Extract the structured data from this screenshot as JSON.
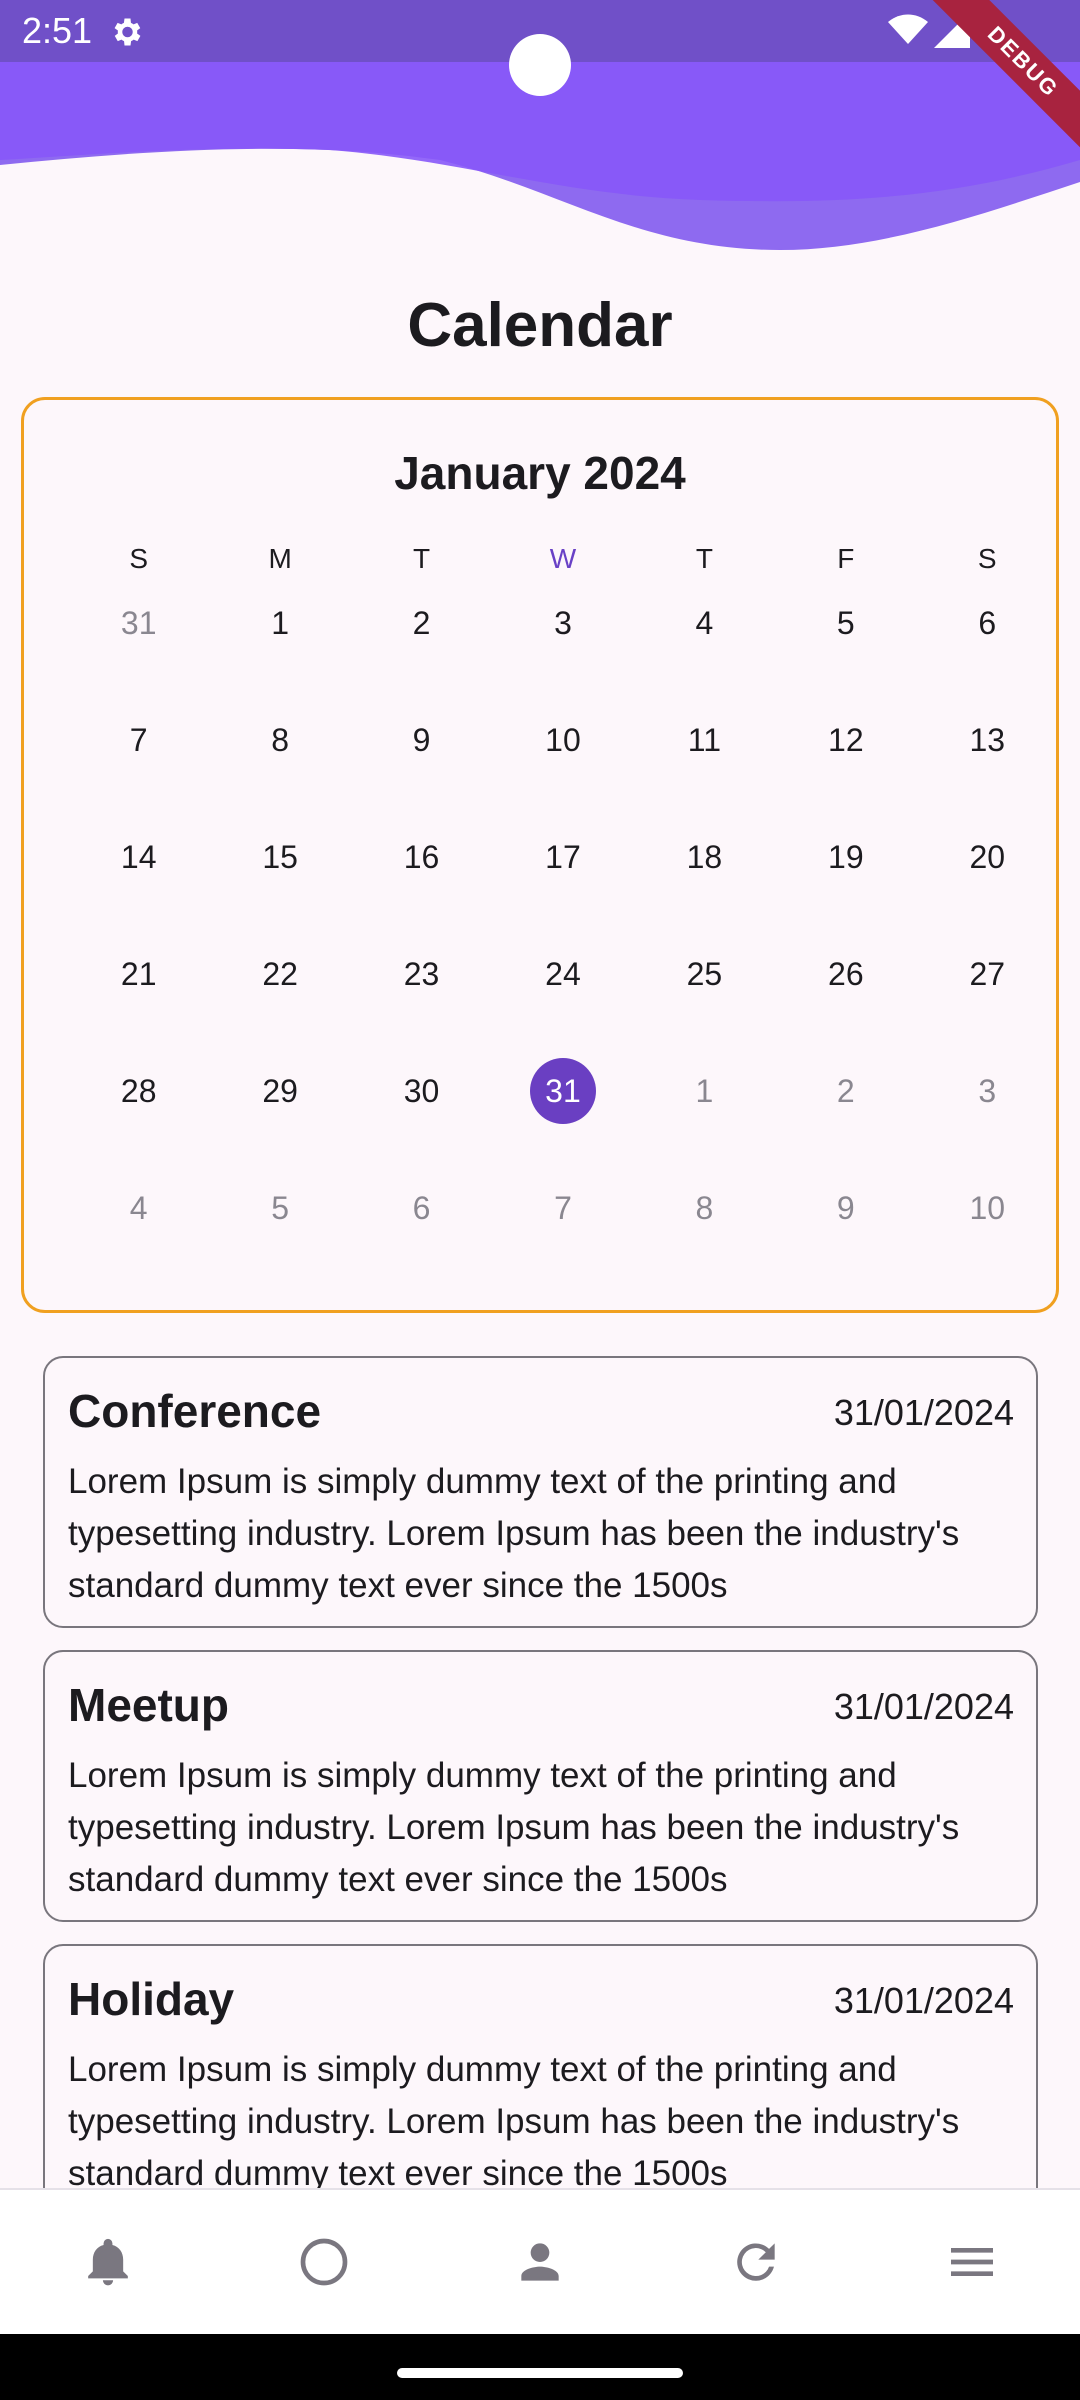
{
  "status_bar": {
    "time": "2:51",
    "debug_label": "DEBUG"
  },
  "page": {
    "title": "Calendar"
  },
  "calendar": {
    "month_label": "January 2024",
    "weekdays": [
      "S",
      "M",
      "T",
      "W",
      "T",
      "F",
      "S"
    ],
    "today_weekday_index": 3,
    "weeks": [
      [
        "31",
        "1",
        "2",
        "3",
        "4",
        "5",
        "6"
      ],
      [
        "7",
        "8",
        "9",
        "10",
        "11",
        "12",
        "13"
      ],
      [
        "14",
        "15",
        "16",
        "17",
        "18",
        "19",
        "20"
      ],
      [
        "21",
        "22",
        "23",
        "24",
        "25",
        "26",
        "27"
      ],
      [
        "28",
        "29",
        "30",
        "31",
        "1",
        "2",
        "3"
      ],
      [
        "4",
        "5",
        "6",
        "7",
        "8",
        "9",
        "10"
      ]
    ],
    "selected_day": "31",
    "colors": {
      "border": "#f0a020",
      "selected": "#6a3fc2"
    }
  },
  "events": [
    {
      "title": "Conference",
      "date": "31/01/2024",
      "description": "Lorem Ipsum is simply dummy text of the printing and typesetting industry. Lorem Ipsum has been the industry's standard dummy text ever since the 1500s"
    },
    {
      "title": "Meetup",
      "date": "31/01/2024",
      "description": "Lorem Ipsum is simply dummy text of the printing and typesetting industry. Lorem Ipsum has been the industry's standard dummy text ever since the 1500s"
    },
    {
      "title": "Holiday",
      "date": "31/01/2024",
      "description": "Lorem Ipsum is simply dummy text of the printing and typesetting industry. Lorem Ipsum has been the industry's standard dummy text ever since the 1500s"
    }
  ],
  "bottom_nav": {
    "items": [
      {
        "icon": "bell-icon"
      },
      {
        "icon": "circle-icon"
      },
      {
        "icon": "person-icon"
      },
      {
        "icon": "refresh-icon"
      },
      {
        "icon": "menu-icon"
      }
    ]
  },
  "theme": {
    "accent": "#7c4dff",
    "background": "#fdf7fb"
  }
}
